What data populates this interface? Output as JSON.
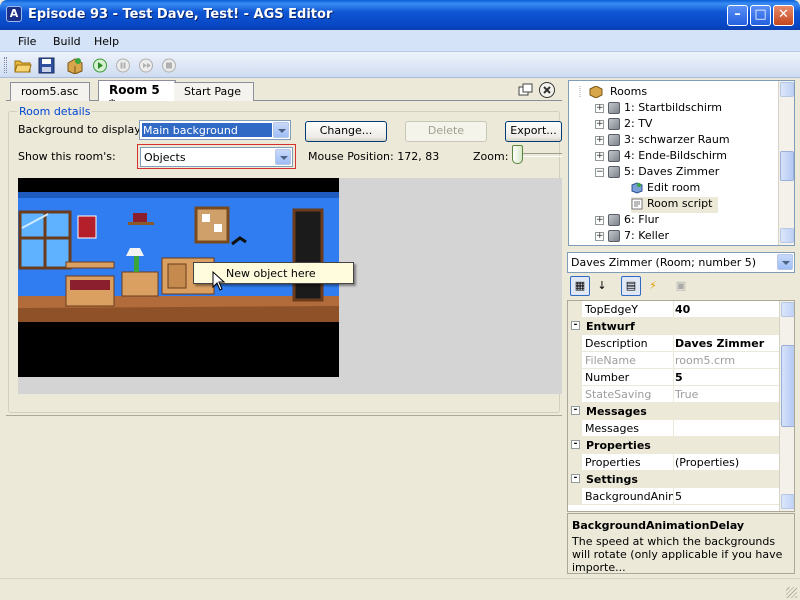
{
  "window": {
    "title": "Episode 93 - Test Dave, Test! - AGS Editor",
    "app_icon": "ags-logo-icon",
    "controls": [
      "minimize",
      "maximize",
      "close"
    ]
  },
  "menu": [
    {
      "label": "File"
    },
    {
      "label": "Build"
    },
    {
      "label": "Help"
    }
  ],
  "toolbar": {
    "icons": [
      "open-folder-icon",
      "save-icon",
      "game-package-icon",
      "run-icon",
      "pause-icon",
      "step-icon",
      "stop-icon"
    ]
  },
  "tabs": [
    {
      "label": "room5.asc",
      "active": false
    },
    {
      "label": "Room 5 *",
      "active": true
    },
    {
      "label": "Start Page",
      "active": false
    }
  ],
  "room_details": {
    "legend": "Room details",
    "background_label": "Background to display:",
    "background_value": "Main background",
    "change_button": "Change...",
    "delete_button": "Delete",
    "export_button": "Export...",
    "show_label": "Show this room's:",
    "show_value": "Objects",
    "mouse_position": "Mouse Position: 172, 83",
    "zoom_label": "Zoom:"
  },
  "popup": {
    "text": "New object here"
  },
  "project_tree": {
    "root": "Rooms",
    "items": [
      {
        "label": "1: Startbildschirm",
        "expanded": false
      },
      {
        "label": "2: TV",
        "expanded": false
      },
      {
        "label": "3: schwarzer Raum",
        "expanded": false
      },
      {
        "label": "4: Ende-Bildschirm",
        "expanded": false
      },
      {
        "label": "5: Daves Zimmer",
        "expanded": true
      },
      {
        "label": "Edit room",
        "child": true
      },
      {
        "label": "Room script",
        "child": true,
        "selected": true
      },
      {
        "label": "6: Flur",
        "expanded": false
      },
      {
        "label": "7: Keller",
        "expanded": false
      }
    ]
  },
  "object_selector": {
    "value": "Daves Zimmer (Room; number 5)"
  },
  "properties": {
    "rows": [
      {
        "kind": "prop",
        "name": "TopEdgeY",
        "value": "40",
        "bold": true
      },
      {
        "kind": "cat",
        "name": "Entwurf"
      },
      {
        "kind": "prop",
        "name": "Description",
        "value": "Daves Zimmer",
        "bold": true
      },
      {
        "kind": "prop",
        "name": "FileName",
        "value": "room5.crm",
        "readonly": true
      },
      {
        "kind": "prop",
        "name": "Number",
        "value": "5",
        "bold": true
      },
      {
        "kind": "prop",
        "name": "StateSaving",
        "value": "True",
        "readonly": true
      },
      {
        "kind": "cat",
        "name": "Messages"
      },
      {
        "kind": "prop",
        "name": "Messages",
        "value": ""
      },
      {
        "kind": "cat",
        "name": "Properties"
      },
      {
        "kind": "prop",
        "name": "Properties",
        "value": "(Properties)"
      },
      {
        "kind": "cat",
        "name": "Settings"
      },
      {
        "kind": "prop",
        "name": "BackgroundAnimat",
        "value": "5"
      }
    ]
  },
  "description": {
    "title": "BackgroundAnimationDelay",
    "text": "The speed at which the backgrounds will rotate (only applicable if you have importe..."
  },
  "colors": {
    "titlebar": "#0a5fd8",
    "accent": "#316ac5",
    "highlight_border": "#d62f2f",
    "popup_bg": "#fffcde"
  }
}
